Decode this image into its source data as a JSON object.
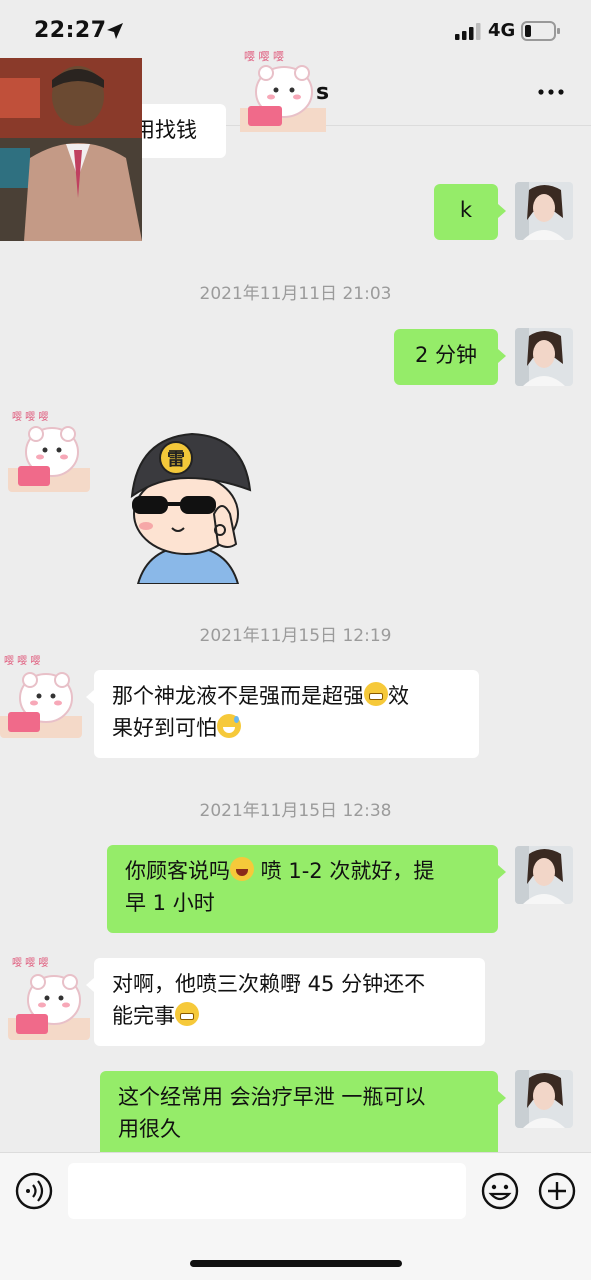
{
  "status_bar": {
    "time": "22:27",
    "network": "4G"
  },
  "header": {
    "title_visible": "s",
    "more_icon": "more-dots-icon"
  },
  "messages": {
    "partial_top_text": "用找钱",
    "m1": "k",
    "t1": "2021年11月11日 21:03",
    "m2": "2 分钟",
    "t2": "2021年11月15日 12:19",
    "m3_a": "那个神龙液不是强而是超强",
    "m3_b": "效",
    "m3_c": "果好到可怕",
    "t3": "2021年11月15日 12:38",
    "m4_a": "你顾客说吗",
    "m4_b": " 喷 1-2 次就好，提",
    "m4_c": "早 1 小时",
    "m5_a": "对啊，他喷三次赖嘢 45 分钟还不",
    "m5_b": "能完事",
    "m6_a": "这个经常用 会治疗早泄  一瓶可以",
    "m6_b": "用很久"
  },
  "sticker": {
    "cap_badge": "雷"
  },
  "input_bar": {
    "placeholder": ""
  },
  "colors": {
    "background": "#ededed",
    "bubble_sent": "#95ec69",
    "bubble_received": "#ffffff",
    "timestamp": "#9b9b9b"
  }
}
